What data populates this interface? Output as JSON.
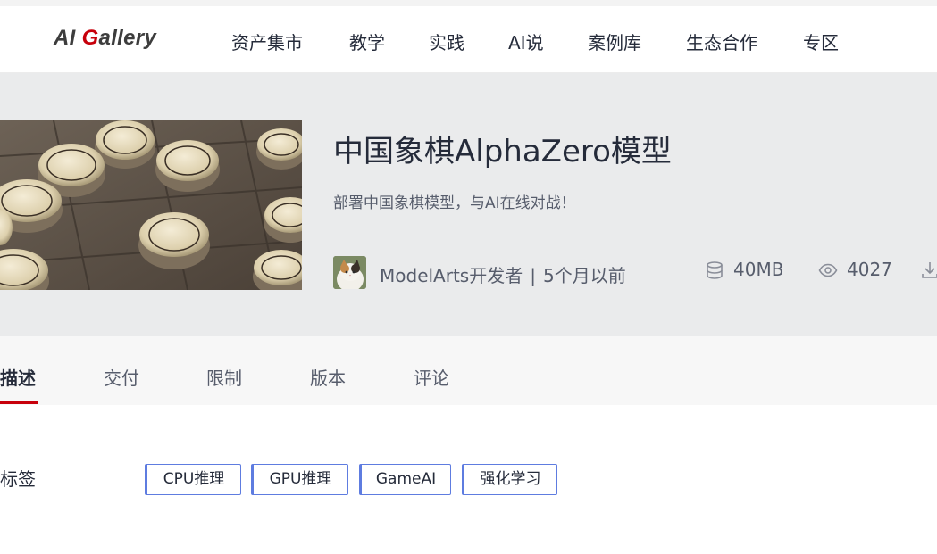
{
  "brand": {
    "logo_prefix": "AI ",
    "logo_g": "G",
    "logo_rest": "allery"
  },
  "nav": {
    "items": [
      {
        "label": "资产集市"
      },
      {
        "label": "教学"
      },
      {
        "label": "实践"
      },
      {
        "label": "AI说"
      },
      {
        "label": "案例库"
      },
      {
        "label": "生态合作"
      },
      {
        "label": "专区"
      }
    ]
  },
  "asset": {
    "title": "中国象棋AlphaZero模型",
    "subtitle": "部署中国象棋模型，与AI在线对战！",
    "author": "ModelArts开发者",
    "separator": "|",
    "updated": "5个月以前",
    "size": "40MB",
    "views": "4027",
    "icons": {
      "size": "database-icon",
      "views": "eye-icon",
      "download": "download-icon"
    }
  },
  "tabs": [
    {
      "label": "描述",
      "active": true
    },
    {
      "label": "交付"
    },
    {
      "label": "限制"
    },
    {
      "label": "版本"
    },
    {
      "label": "评论"
    }
  ],
  "tags": {
    "label": "标签",
    "items": [
      "CPU推理",
      "GPU推理",
      "GameAI",
      "强化学习"
    ]
  },
  "colors": {
    "accent": "#c7000b",
    "tag_border": "#5e7ce0",
    "hero_bg": "#eaebec",
    "text_primary": "#252b3a",
    "text_secondary": "#575d6c"
  }
}
